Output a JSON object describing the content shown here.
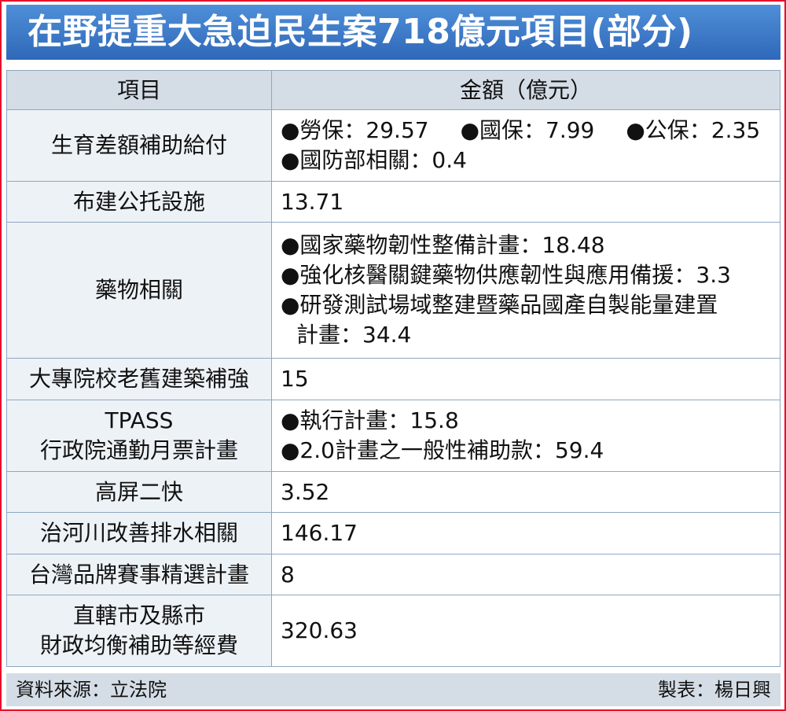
{
  "title": "在野提重大急迫民生案718億元項目(部分)",
  "header": {
    "item": "項目",
    "amount": "金額（億元）"
  },
  "rows": [
    {
      "item": [
        "生育差額補助給付"
      ],
      "amount": [
        [
          "●勞保：29.57",
          "●國保：7.99",
          "●公保：2.35"
        ],
        [
          "●國防部相關：0.4"
        ]
      ]
    },
    {
      "item": [
        "布建公托設施"
      ],
      "amount": [
        [
          "13.71"
        ]
      ]
    },
    {
      "item": [
        "藥物相關"
      ],
      "amount": [
        [
          "●國家藥物韌性整備計畫：18.48"
        ],
        [
          "●強化核醫關鍵藥物供應韌性與應用備援：3.3"
        ],
        [
          "●研發測試場域整建暨藥品國產自製能量建置"
        ],
        [
          "計畫：34.4"
        ]
      ]
    },
    {
      "item": [
        "大專院校老舊建築補強"
      ],
      "amount": [
        [
          "15"
        ]
      ]
    },
    {
      "item": [
        "TPASS",
        "行政院通勤月票計畫"
      ],
      "amount": [
        [
          "●執行計畫：15.8"
        ],
        [
          "●2.0計畫之一般性補助款：59.4"
        ]
      ]
    },
    {
      "item": [
        "高屏二快"
      ],
      "amount": [
        [
          "3.52"
        ]
      ]
    },
    {
      "item": [
        "治河川改善排水相關"
      ],
      "amount": [
        [
          "146.17"
        ]
      ]
    },
    {
      "item": [
        "台灣品牌賽事精選計畫"
      ],
      "amount": [
        [
          "8"
        ]
      ]
    },
    {
      "item": [
        "直轄市及縣市",
        "財政均衡補助等經費"
      ],
      "amount": [
        [
          "320.63"
        ]
      ]
    }
  ],
  "footer": {
    "source": "資料來源：立法院",
    "maker": "製表：楊日興"
  }
}
